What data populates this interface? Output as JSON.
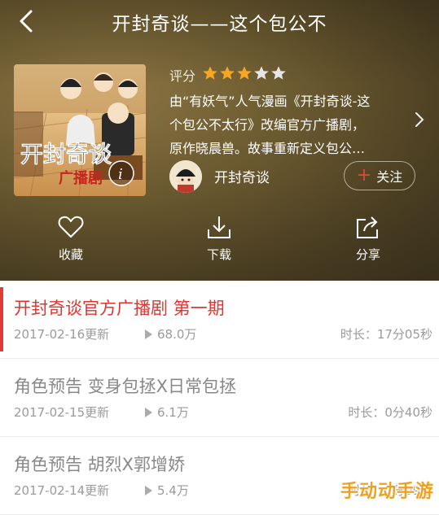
{
  "header": {
    "title": "开封奇谈——这个包公不",
    "rating_label": "评分",
    "rating": 3,
    "rating_max": 5,
    "description_lines": [
      "由“有妖气”人气漫画《开封奇谈-这",
      "个包公不太行》改编官方广播剧，",
      "原作晓晨兽。故事重新定义包公…"
    ],
    "author_name": "开封奇谈",
    "follow_label": "关注",
    "cover_text": "开封奇谈",
    "cover_subtext": "广播剧",
    "cover_info_icon": "i"
  },
  "actions": [
    {
      "label": "收藏",
      "icon": "heart-icon"
    },
    {
      "label": "下载",
      "icon": "download-icon"
    },
    {
      "label": "分享",
      "icon": "share-icon"
    }
  ],
  "episodes": [
    {
      "title": "开封奇谈官方广播剧 第一期",
      "date": "2017-02-16更新",
      "plays": "68.0万",
      "duration": "时长：17分05秒",
      "active": true
    },
    {
      "title": "角色预告 变身包拯X日常包拯",
      "date": "2017-02-15更新",
      "plays": "6.1万",
      "duration": "时长：0分40秒",
      "active": false
    },
    {
      "title": "角色预告 胡烈X郭增娇",
      "date": "2017-02-14更新",
      "plays": "5.4万",
      "duration": "时长：0分09秒",
      "active": false
    }
  ],
  "watermark": "手动动手游",
  "colors": {
    "accent": "#e2342c",
    "star_on": "#f5a623",
    "star_off": "#e6e6e6",
    "header_bg": "#6b5a30"
  }
}
